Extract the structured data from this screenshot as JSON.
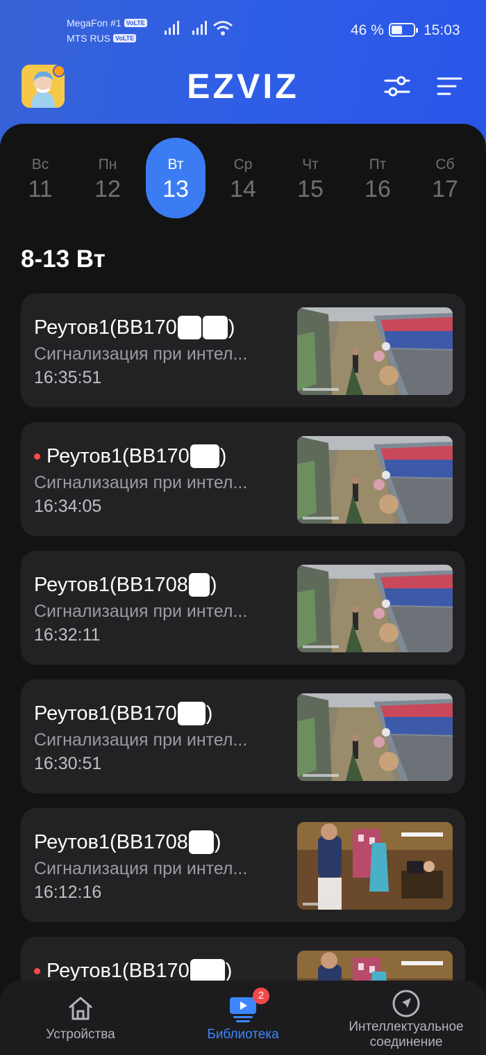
{
  "status_bar": {
    "carrier1": "MegaFon #1",
    "carrier2": "MTS RUS",
    "volte": "VoLTE",
    "battery": "46 %",
    "time": "15:03"
  },
  "header": {
    "logo": "EZVIZ",
    "icons": [
      "avatar-icon",
      "filter-sliders-icon",
      "sort-menu-icon"
    ]
  },
  "days": [
    {
      "wd": "Вс",
      "dn": "11"
    },
    {
      "wd": "Пн",
      "dn": "12"
    },
    {
      "wd": "Вт",
      "dn": "13"
    },
    {
      "wd": "Ср",
      "dn": "14"
    },
    {
      "wd": "Чт",
      "dn": "15"
    },
    {
      "wd": "Пт",
      "dn": "16"
    },
    {
      "wd": "Сб",
      "dn": "17"
    }
  ],
  "selected_day": "13",
  "section_title": "8-13 Вт",
  "events": [
    {
      "name": "Реутов1(BB170",
      "suffix": ")",
      "unread": false,
      "desc": "Сигнализация при интел...",
      "time": "16:35:51"
    },
    {
      "name": "Реутов1(BB170",
      "suffix": ")",
      "unread": true,
      "desc": "Сигнализация при интел...",
      "time": "16:34:05"
    },
    {
      "name": "Реутов1(BB1708",
      "suffix": ")",
      "unread": false,
      "desc": "Сигнализация при интел...",
      "time": "16:32:11"
    },
    {
      "name": "Реутов1(BB170",
      "suffix": ")",
      "unread": false,
      "desc": "Сигнализация при интел...",
      "time": "16:30:51"
    },
    {
      "name": "Реутов1(BB1708",
      "suffix": ")",
      "unread": false,
      "desc": "Сигнализация при интел...",
      "time": "16:12:16"
    },
    {
      "name": "Реутов1(BB170",
      "suffix": ")",
      "unread": true,
      "desc": "",
      "time": ""
    }
  ],
  "nav": {
    "devices": "Устройства",
    "library": "Библиотека",
    "library_badge": "2",
    "smart_link_1": "Интеллектуальное",
    "smart_link_2": "соединение"
  },
  "colors": {
    "accent": "#3b7cf2",
    "header_bg": "#2f5ee6",
    "unread_dot": "#ff4a4a"
  }
}
